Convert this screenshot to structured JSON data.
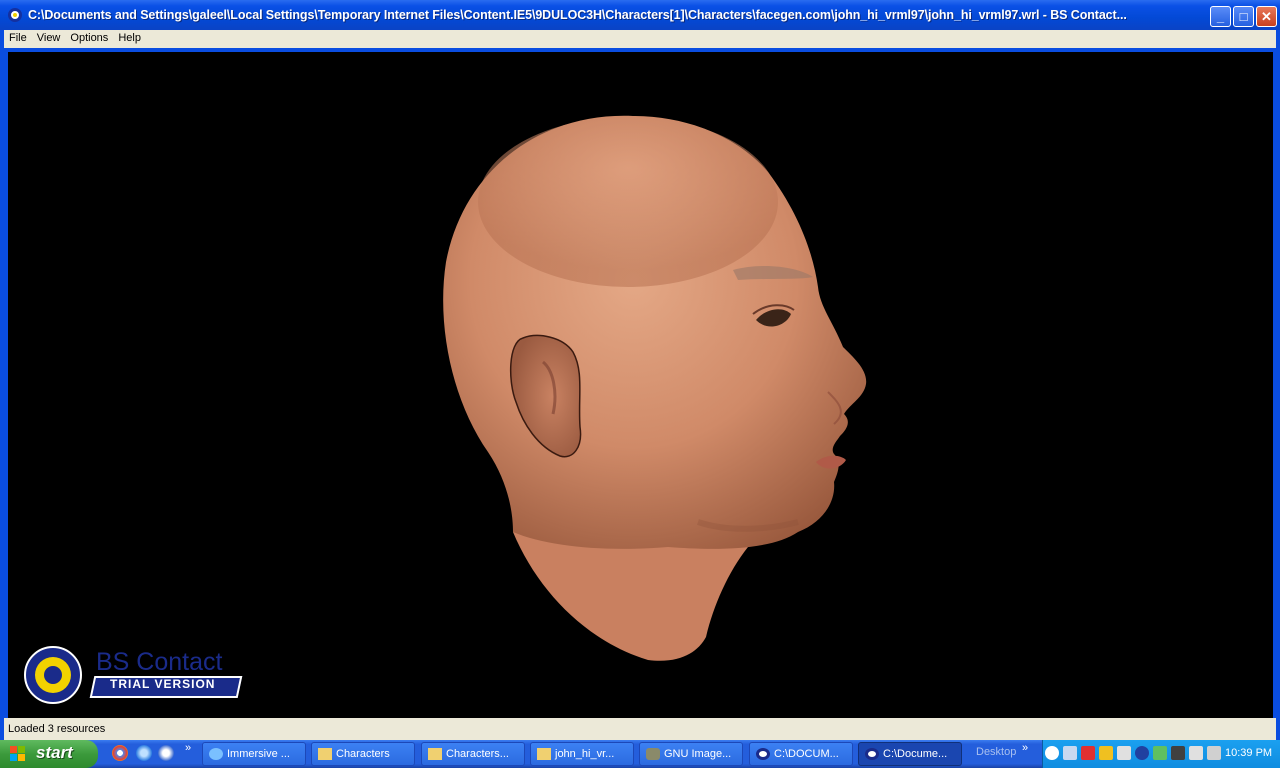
{
  "window": {
    "title": "C:\\Documents and Settings\\galeel\\Local Settings\\Temporary Internet Files\\Content.IE5\\9DULOC3H\\Characters[1]\\Characters\\facegen.com\\john_hi_vrml97\\john_hi_vrml97.wrl - BS Contact..."
  },
  "menu": {
    "file": "File",
    "view": "View",
    "options": "Options",
    "help": "Help"
  },
  "logo": {
    "title": "BS Contact",
    "subtitle": "TRIAL VERSION"
  },
  "status": {
    "text": "Loaded 3 resources"
  },
  "taskbar": {
    "start_label": "start",
    "tasks": [
      {
        "label": "Immersive ...",
        "icon": "ie-icon"
      },
      {
        "label": "Characters",
        "icon": "folder-icon"
      },
      {
        "label": "Characters...",
        "icon": "folder-icon"
      },
      {
        "label": "john_hi_vr...",
        "icon": "folder-icon"
      },
      {
        "label": "GNU Image...",
        "icon": "gimp-icon"
      },
      {
        "label": "C:\\DOCUM...",
        "icon": "bscontact-icon"
      },
      {
        "label": "C:\\Docume...",
        "icon": "bscontact-icon"
      }
    ],
    "desktop_label": "Desktop",
    "clock": "10:39 PM"
  },
  "colors": {
    "titlebar": "#0a50e6",
    "viewport": "#000000",
    "skin": "#d89a78",
    "taskbar": "#245edc",
    "tray": "#0f8ce0"
  }
}
